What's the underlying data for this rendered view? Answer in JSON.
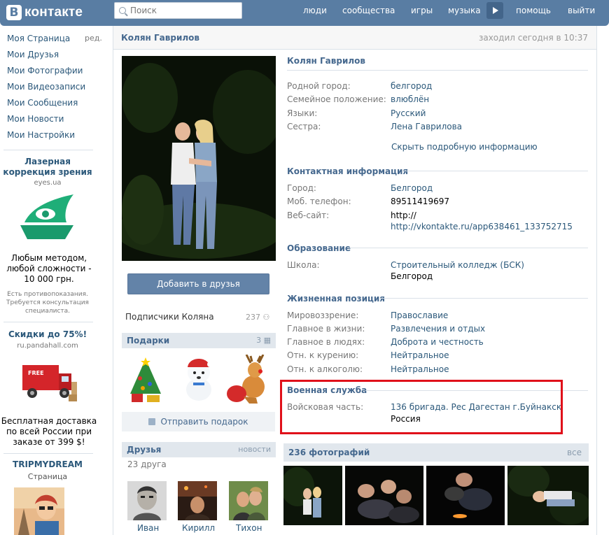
{
  "header": {
    "logo_letter": "В",
    "logo_text": "контакте",
    "search_placeholder": "Поиск",
    "nav": [
      "люди",
      "сообщества",
      "игры",
      "музыка",
      "помощь",
      "выйти"
    ]
  },
  "sidebar": {
    "items": [
      "Моя Страница",
      "Мои Друзья",
      "Мои Фотографии",
      "Мои Видеозаписи",
      "Мои Сообщения",
      "Мои Новости",
      "Мои Настройки"
    ],
    "edit_label": "ред.",
    "ads": [
      {
        "title": "Лазерная коррекция зрения",
        "domain": "eyes.ua",
        "text": "Любым методом, любой сложности - 10 000 грн.",
        "small": "Есть противопоказания. Требуется консультация специалиста."
      },
      {
        "title": "Скидки до 75%!",
        "domain": "ru.pandahall.com",
        "text": "Бесплатная доставка по всей России при заказе от 399 $!",
        "badge": "FREE"
      },
      {
        "title": "TRIPMYDREAM",
        "domain": "Страница"
      }
    ]
  },
  "profile": {
    "name": "Колян Гаврилов",
    "online": "заходил сегодня в 10:37",
    "add_friend": "Добавить в друзья",
    "subscribers_label": "Подписчики Коляна",
    "subscribers_count": "237",
    "gifts_label": "Подарки",
    "gifts_count": "3",
    "send_gift": "Отправить подарок",
    "friends_label": "Друзья",
    "friends_news": "новости",
    "friends_count": "23 друга",
    "friends": [
      "Иван",
      "Кирилл",
      "Тихон"
    ]
  },
  "info": {
    "title": "Колян Гаврилов",
    "basic": [
      {
        "label": "Родной город:",
        "value": "белгород"
      },
      {
        "label": "Семейное положение:",
        "value": "влюблён"
      },
      {
        "label": "Языки:",
        "value": "Русский"
      },
      {
        "label": "Сестра:",
        "value": "Лена Гаврилова"
      }
    ],
    "hide_link": "Скрыть подробную информацию",
    "contact_title": "Контактная информация",
    "contact": [
      {
        "label": "Город:",
        "value": "Белгород"
      },
      {
        "label": "Моб. телефон:",
        "value": "89511419697"
      },
      {
        "label": "Веб-сайт:",
        "value": "http://",
        "value2": "http://vkontakte.ru/app638461_133752715"
      }
    ],
    "education_title": "Образование",
    "school_label": "Школа:",
    "school_value": "Строительный колледж (БСК)",
    "school_city": "Белгород",
    "life_title": "Жизненная позиция",
    "life": [
      {
        "label": "Мировоззрение:",
        "value": "Православие"
      },
      {
        "label": "Главное в жизни:",
        "value": "Развлечения и отдых"
      },
      {
        "label": "Главное в людях:",
        "value": "Доброта и честность"
      },
      {
        "label": "Отн. к курению:",
        "value": "Нейтральное"
      },
      {
        "label": "Отн. к алкоголю:",
        "value": "Нейтральное"
      }
    ],
    "military_title": "Военная служба",
    "military_label": "Войсковая часть:",
    "military_value": "136 бригада. Рес Дагестан г.Буйнакск",
    "military_country": "Россия"
  },
  "photos": {
    "title": "236 фотографий",
    "all_label": "все"
  }
}
